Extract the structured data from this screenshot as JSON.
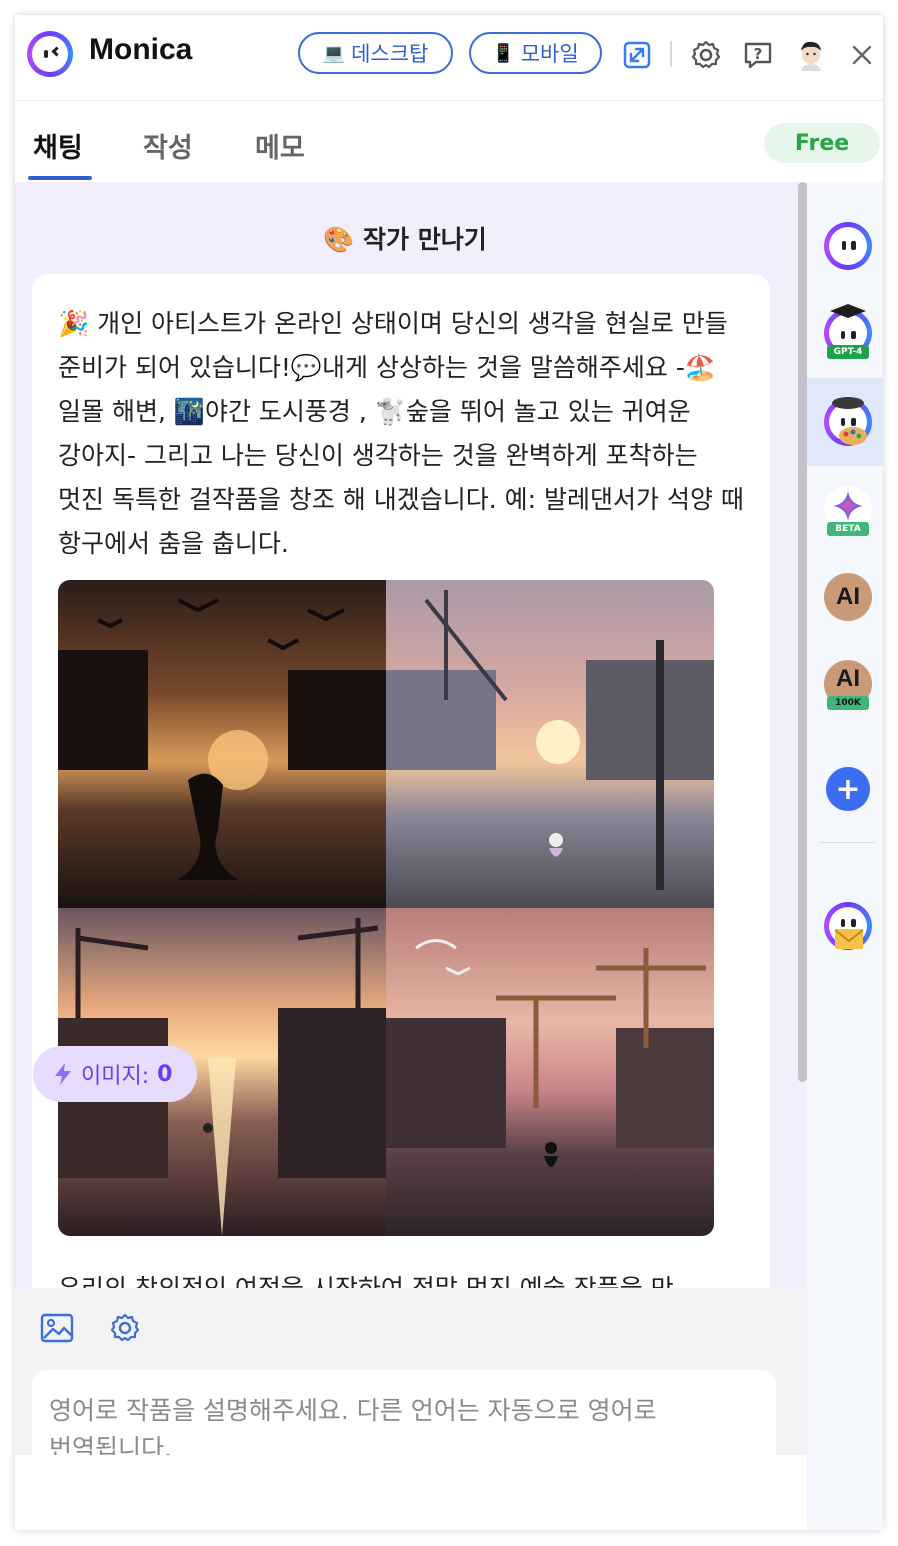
{
  "header": {
    "app_title": "Monica",
    "desktop_label": "데스크탑",
    "desktop_emoji": "💻",
    "mobile_label": "모바일",
    "mobile_emoji": "📱"
  },
  "tabs": [
    {
      "label": "채팅",
      "active": true
    },
    {
      "label": "작성",
      "active": false
    },
    {
      "label": "메모",
      "active": false
    }
  ],
  "plan_badge": "Free",
  "chat": {
    "bot_name": "🎨 작가 만나기",
    "message": "🎉 개인 아티스트가 온라인 상태이며 당신의 생각을 현실로 만들 준비가 되어 있습니다!💬내게 상상하는 것을 말씀해주세요 -🏖️일몰 해변, 🌃야간 도시풍경 , 🐩숲을 뛰어 놀고 있는 귀여운 강아지- 그리고 나는 당신이 생각하는 것을 완벽하게 포착하는 멋진 독특한 걸작품을 창조 해 내겠습니다. 예: 발레댄서가 석양 때 항구에서 춤을 춥니다.",
    "images": [
      "ballerina-harbor-sunset-1",
      "ballerina-harbor-sunset-2",
      "ballerina-harbor-sunset-3",
      "ballerina-harbor-sunset-4"
    ],
    "credits_label": "이미지:",
    "credits_value": "0",
    "message2": "우리의 창의적인 여정을 시작하여 정말 멋진 예술 작품을 만"
  },
  "composer": {
    "placeholder": "영어로 작품을 설명해주세요. 다른 언어는 자동으로 영어로 번역됩니다."
  },
  "rail": {
    "gpt4_tag": "GPT-4",
    "beta_tag": "BETA",
    "claude_label": "AI",
    "claude100k_tag": "100K",
    "add_label": "+"
  },
  "colors": {
    "accent": "#2f5fd0",
    "chat_bg": "#f2eefd",
    "free_green": "#27a647",
    "credit_purple": "#6b3cf0"
  }
}
